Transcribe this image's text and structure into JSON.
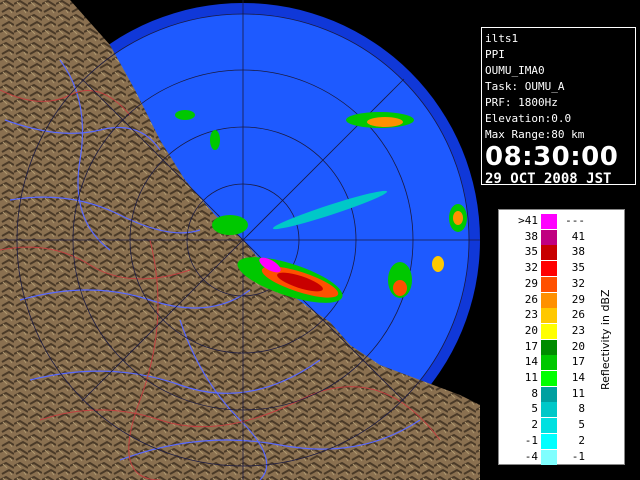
{
  "info": {
    "station": "ilts1",
    "scan_type": "PPI",
    "site": "OUMU_IMA0",
    "task": "Task: OUMU_A",
    "prf": "PRF: 1800Hz",
    "elevation": "Elevation:0.0",
    "max_range": "Max Range:80 km",
    "time": "08:30:00",
    "date": "29 OCT 2008 JST"
  },
  "legend": {
    "title": "Reflectivity in dBZ",
    "rows": [
      {
        "lo": ">41",
        "hi": "---",
        "color": "#ff00ff"
      },
      {
        "lo": "38",
        "hi": "41",
        "color": "#c00080"
      },
      {
        "lo": "35",
        "hi": "38",
        "color": "#c80000"
      },
      {
        "lo": "32",
        "hi": "35",
        "color": "#ff0000"
      },
      {
        "lo": "29",
        "hi": "32",
        "color": "#ff5000"
      },
      {
        "lo": "26",
        "hi": "29",
        "color": "#ff9000"
      },
      {
        "lo": "23",
        "hi": "26",
        "color": "#ffc800"
      },
      {
        "lo": "20",
        "hi": "23",
        "color": "#ffff00"
      },
      {
        "lo": "17",
        "hi": "20",
        "color": "#008c00"
      },
      {
        "lo": "14",
        "hi": "17",
        "color": "#00c800"
      },
      {
        "lo": "11",
        "hi": "14",
        "color": "#00ff00"
      },
      {
        "lo": "8",
        "hi": "11",
        "color": "#00a0a0"
      },
      {
        "lo": "5",
        "hi": "8",
        "color": "#00c8c8"
      },
      {
        "lo": "2",
        "hi": "5",
        "color": "#00e0e0"
      },
      {
        "lo": "-1",
        "hi": "2",
        "color": "#00ffff"
      },
      {
        "lo": "-4",
        "hi": "-1",
        "color": "#80ffff"
      }
    ]
  },
  "colors": {
    "background": "#000000",
    "sea_coverage": "#1e5aff",
    "outer_coverage": "#1038d8",
    "land": "#8a7050",
    "land_shadow": "#4a3a28",
    "river": "#5a6aff",
    "boundary": "#c04040",
    "range_ring": "#1a1a40"
  }
}
